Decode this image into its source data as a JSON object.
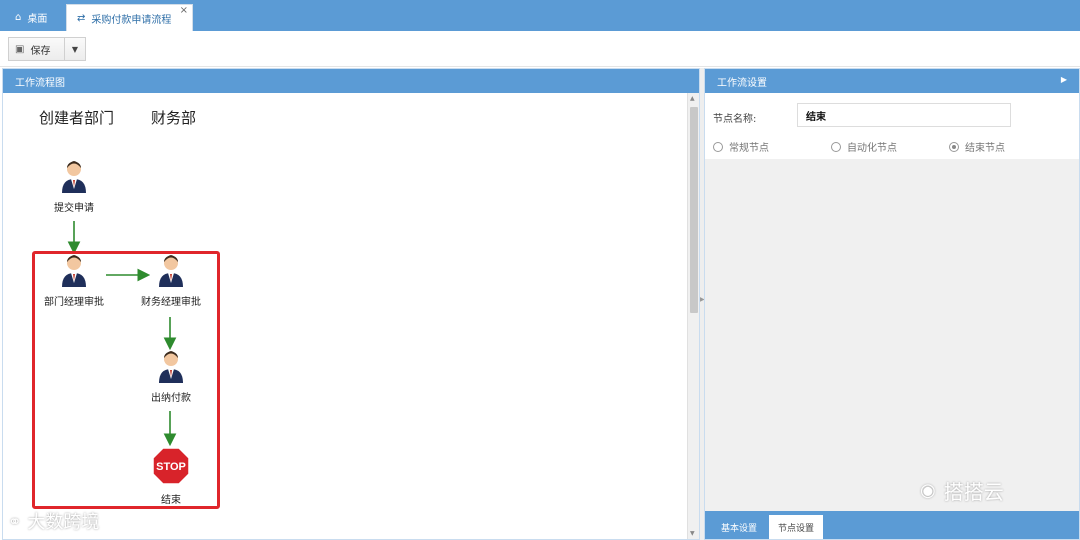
{
  "tabs": {
    "home": {
      "label": "桌面",
      "icon": "home-icon"
    },
    "active": {
      "label": "采购付款申请流程",
      "icon": "shuffle-icon",
      "close": "×"
    }
  },
  "toolbar": {
    "save_label": "保存",
    "save_icon": "save-icon",
    "dropdown_icon": "▼"
  },
  "left_panel": {
    "title": "工作流程图"
  },
  "lanes": [
    "创建者部门",
    "财务部"
  ],
  "nodes": [
    {
      "label": "提交申请",
      "type": "person"
    },
    {
      "label": "部门经理审批",
      "type": "person"
    },
    {
      "label": "财务经理审批",
      "type": "person"
    },
    {
      "label": "出纳付款",
      "type": "person"
    },
    {
      "label": "结束",
      "type": "stop",
      "sign_text": "STOP"
    }
  ],
  "right_panel": {
    "title": "工作流设置",
    "node_name_label": "节点名称:",
    "node_name_value": "结束",
    "radios": [
      {
        "label": "常规节点",
        "checked": false
      },
      {
        "label": "自动化节点",
        "checked": false
      },
      {
        "label": "结束节点",
        "checked": true
      }
    ],
    "bottom_tabs": [
      "基本设置",
      "节点设置"
    ]
  },
  "watermarks": {
    "right": "搭搭云",
    "left": "大数跨境"
  },
  "colors": {
    "header_blue": "#5b9bd5",
    "highlight_red": "#e0262b",
    "arrow_green": "#2e8b2e",
    "stop_red": "#d8232a"
  }
}
